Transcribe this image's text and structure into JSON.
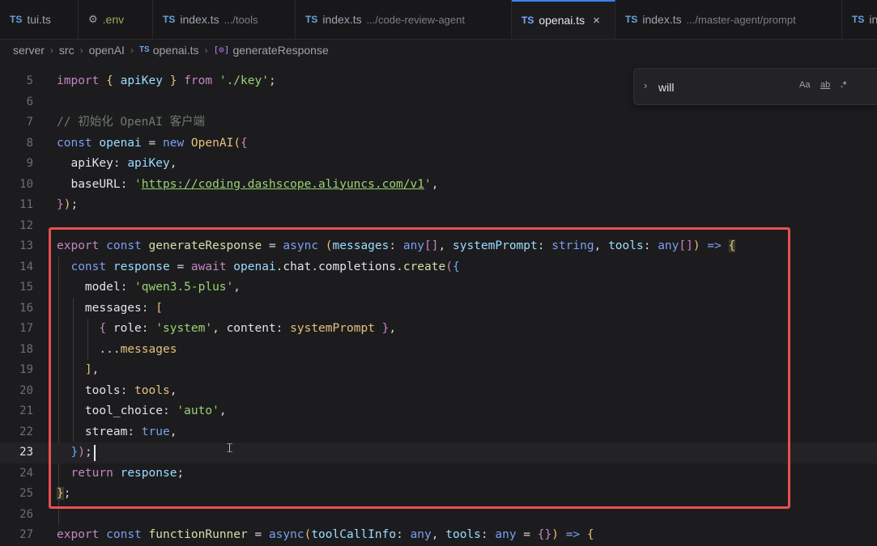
{
  "tabs": [
    {
      "icon": "TS",
      "label": "tui.ts",
      "hint": ""
    },
    {
      "icon": "gear",
      "label": ".env",
      "hint": ""
    },
    {
      "icon": "TS",
      "label": "index.ts",
      "hint": ".../tools"
    },
    {
      "icon": "TS",
      "label": "index.ts",
      "hint": ".../code-review-agent"
    },
    {
      "icon": "TS",
      "label": "openai.ts",
      "hint": "",
      "active": true,
      "close": "×"
    },
    {
      "icon": "TS",
      "label": "index.ts",
      "hint": ".../master-agent/prompt"
    },
    {
      "icon": "TS",
      "label": "in",
      "hint": ""
    }
  ],
  "breadcrumb": {
    "server": "server",
    "src": "src",
    "openAI": "openAI",
    "file_icon": "TS",
    "file": "openai.ts",
    "symbol_icon": "[⊙]",
    "symbol": "generateResponse"
  },
  "find": {
    "chevron": "›",
    "value": "will",
    "match_case": "Aa",
    "whole_word": "ab",
    "regex": ".*"
  },
  "lines": [
    {
      "n": "5"
    },
    {
      "n": "6"
    },
    {
      "n": "7"
    },
    {
      "n": "8"
    },
    {
      "n": "9"
    },
    {
      "n": "10"
    },
    {
      "n": "11"
    },
    {
      "n": "12"
    },
    {
      "n": "13"
    },
    {
      "n": "14"
    },
    {
      "n": "15"
    },
    {
      "n": "16"
    },
    {
      "n": "17"
    },
    {
      "n": "18"
    },
    {
      "n": "19"
    },
    {
      "n": "20"
    },
    {
      "n": "21"
    },
    {
      "n": "22"
    },
    {
      "n": "23"
    },
    {
      "n": "24"
    },
    {
      "n": "25"
    },
    {
      "n": "26"
    },
    {
      "n": "27"
    }
  ],
  "code": {
    "l5": {
      "kw": "import",
      "b1": "{",
      "id": "apiKey",
      "b2": "}",
      "from": "from",
      "str": "'./key'",
      "end": ";"
    },
    "l7": {
      "comment": "// 初始化 OpenAI 客户端"
    },
    "l8": {
      "kw": "const",
      "id": "openai",
      "eq": "=",
      "new": "new",
      "cls": "OpenAI",
      "b1": "(",
      "b2": "{"
    },
    "l9": {
      "prop": "apiKey",
      "colon": ":",
      "val": "apiKey",
      "comma": ","
    },
    "l10": {
      "prop": "baseURL",
      "colon": ":",
      "q1": "'",
      "url": "https://coding.dashscope.aliyuncs.com/v1",
      "q2": "'",
      "comma": ","
    },
    "l11": {
      "b1": "}",
      "b2": ")",
      "end": ";"
    },
    "l13": {
      "export": "export",
      "const": "const",
      "fn": "generateResponse",
      "eq": "=",
      "async": "async",
      "p1": "(",
      "a1": "messages",
      "c1": ":",
      "t1": "any",
      "br1": "[]",
      "comma1": ",",
      "a2": "systemPrompt",
      "c2": ":",
      "t2": "string",
      "comma2": ",",
      "a3": "tools",
      "c3": ":",
      "t3": "any",
      "br3": "[]",
      "p2": ")",
      "arrow": "=>",
      "b": "{"
    },
    "l14": {
      "const": "const",
      "id": "response",
      "eq": "=",
      "await": "await",
      "obj": "openai",
      "dot1": ".",
      "p1": "chat",
      "dot2": ".",
      "p2": "completions",
      "dot3": ".",
      "fn": "create",
      "b1": "(",
      "b2": "{"
    },
    "l15": {
      "prop": "model",
      "colon": ":",
      "str": "'qwen3.5-plus'",
      "comma": ","
    },
    "l16": {
      "prop": "messages",
      "colon": ":",
      "b": "["
    },
    "l17": {
      "b1": "{",
      "p1": "role",
      "c1": ":",
      "s1": "'system'",
      "comma": ",",
      "p2": "content",
      "c2": ":",
      "v2": "systemPrompt",
      "b2": "}",
      "end": ","
    },
    "l18": {
      "spread": "...",
      "id": "messages"
    },
    "l19": {
      "b": "]",
      "end": ","
    },
    "l20": {
      "prop": "tools",
      "colon": ":",
      "val": "tools",
      "comma": ","
    },
    "l21": {
      "prop": "tool_choice",
      "colon": ":",
      "str": "'auto'",
      "comma": ","
    },
    "l22": {
      "prop": "stream",
      "colon": ":",
      "val": "true",
      "comma": ","
    },
    "l23": {
      "b1": "}",
      "b2": ")",
      "end": ";"
    },
    "l24": {
      "ret": "return",
      "id": "response",
      "end": ";"
    },
    "l25": {
      "b": "}",
      "end": ";"
    },
    "l27": {
      "export": "export",
      "const": "const",
      "fn": "functionRunner",
      "eq": "=",
      "async": "async",
      "p1": "(",
      "a1": "toolCallInfo",
      "c1": ":",
      "t1": "any",
      "comma1": ",",
      "a2": "tools",
      "c2": ":",
      "t2": "any",
      "eq2": "=",
      "obj": "{}",
      "p2": ")",
      "arrow": "=>",
      "b": "{"
    }
  },
  "colors": {
    "accent": "#3b82f6",
    "highlight_border": "#e8504f"
  }
}
